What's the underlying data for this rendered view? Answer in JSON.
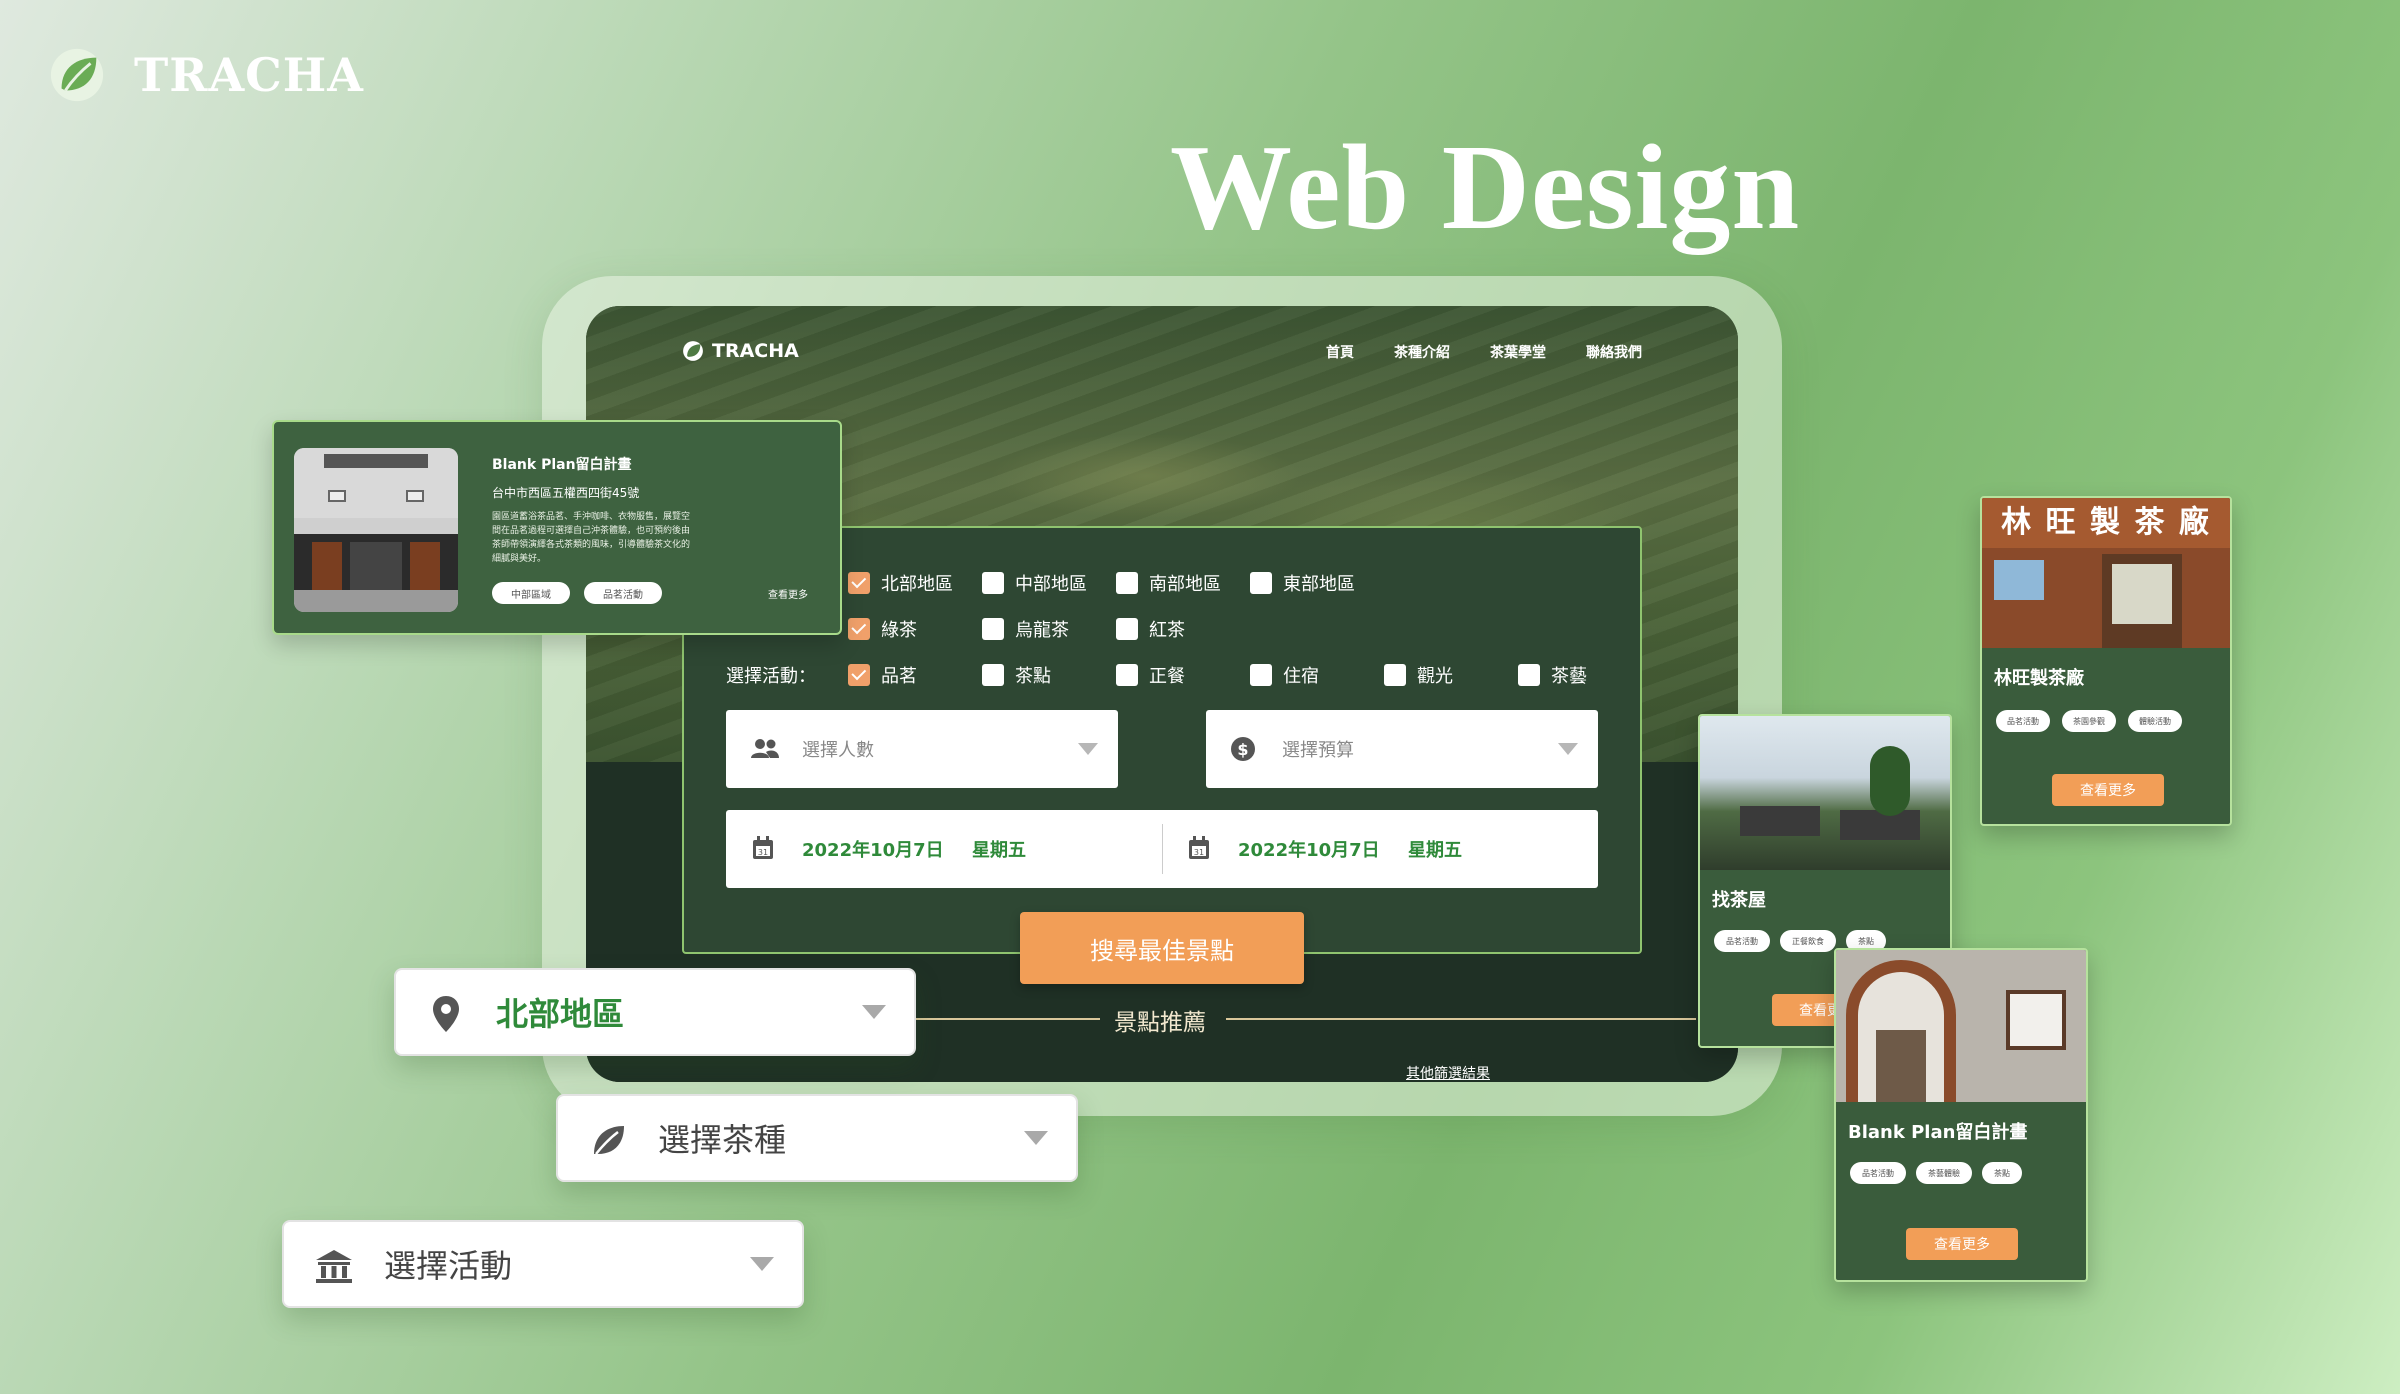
{
  "brand": {
    "name": "TRACHA"
  },
  "hero": {
    "title": "Web Design"
  },
  "site": {
    "logo": "TRACHA",
    "nav": [
      "首頁",
      "茶種介紹",
      "茶葉學堂",
      "聯絡我們"
    ]
  },
  "filters": {
    "regions": [
      {
        "label": "北部地區",
        "checked": true
      },
      {
        "label": "中部地區",
        "checked": false
      },
      {
        "label": "南部地區",
        "checked": false
      },
      {
        "label": "東部地區",
        "checked": false
      }
    ],
    "teas": [
      {
        "label": "綠茶",
        "checked": true
      },
      {
        "label": "烏龍茶",
        "checked": false
      },
      {
        "label": "紅茶",
        "checked": false
      }
    ],
    "activity_label": "選擇活動：",
    "activities": [
      {
        "label": "品茗",
        "checked": true
      },
      {
        "label": "茶點",
        "checked": false
      },
      {
        "label": "正餐",
        "checked": false
      },
      {
        "label": "住宿",
        "checked": false
      },
      {
        "label": "觀光",
        "checked": false
      },
      {
        "label": "茶藝",
        "checked": false
      }
    ],
    "people_placeholder": "選擇人數",
    "budget_placeholder": "選擇預算",
    "date_start": "2022年10月7日",
    "weekday_start": "星期五",
    "date_end": "2022年10月7日",
    "weekday_end": "星期五",
    "search_button": "搜尋最佳景點"
  },
  "recommend": {
    "title": "景點推薦",
    "other_link": "其他篩選結果"
  },
  "featured": {
    "name": "Blank Plan留白計畫",
    "address": "台中市西區五權西四街45號",
    "desc_lines": [
      "園區道蓄浴茶品茗、手沖咖啡、衣物服售，展覽空",
      "間在品茗過程可選擇自己沖茶體驗，也可預約後由",
      "茶師帶領演繹各式茶類的風味，引導體驗茶文化的",
      "細膩與美好。"
    ],
    "tags": [
      "中部區域",
      "品茗活動"
    ],
    "more": "查看更多"
  },
  "cards": {
    "lin": {
      "name": "林旺製茶廠",
      "sign": "林 旺 製 茶 廠",
      "tags": [
        "品茗活動",
        "茶園參觀",
        "體驗活動"
      ],
      "more": "查看更多"
    },
    "teahouse": {
      "name": "找茶屋",
      "tags": [
        "品茗活動",
        "正餐飲食",
        "茶點"
      ],
      "more": "查看更多"
    },
    "blank": {
      "name": "Blank Plan留白計畫",
      "tags": [
        "品茗活動",
        "茶藝體驗",
        "茶點"
      ],
      "more": "查看更多"
    }
  },
  "dropdowns": {
    "region": "北部地區",
    "tea": "選擇茶種",
    "activity": "選擇活動"
  },
  "colors": {
    "accent": "#f29e57",
    "brand_green": "#2f8a3a",
    "panel": "#2e4733"
  }
}
